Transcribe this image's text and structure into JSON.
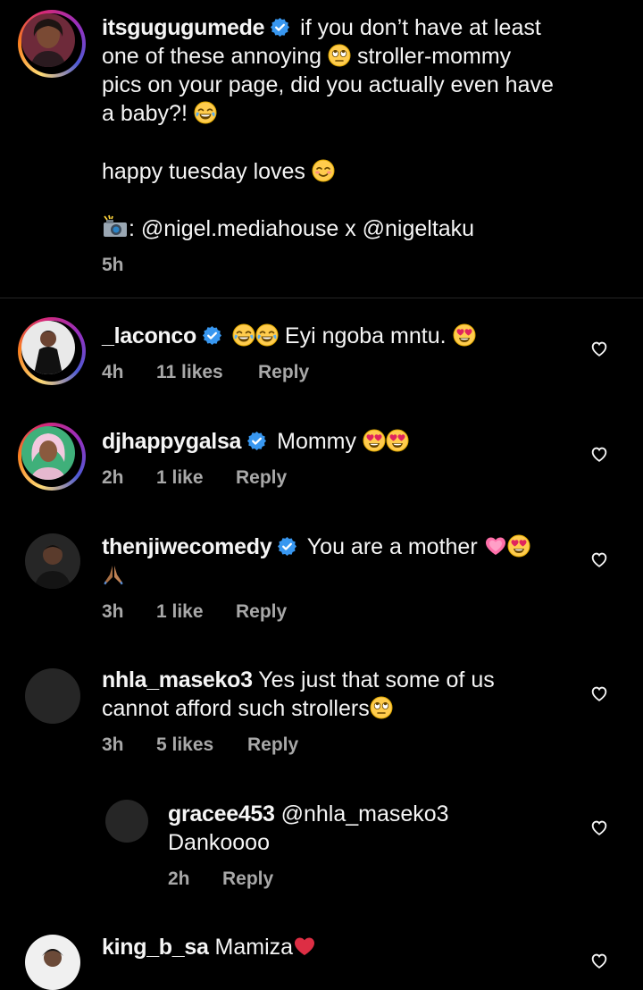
{
  "caption": {
    "username": "itsgugugumede",
    "line1": "if you don’t have at least",
    "line2a": "one of these annoying",
    "line2b": "stroller-mommy",
    "line3": "pics on your page, did you actually even have",
    "line4": "a baby?!",
    "line5": "happy tuesday loves",
    "line6": ": @nigel.mediahouse x @nigeltaku",
    "time": "5h"
  },
  "comments": [
    {
      "username": "_laconco",
      "text": "Eyi ngoba mntu.",
      "time": "4h",
      "likes": "11 likes",
      "reply": "Reply"
    },
    {
      "username": "djhappygalsa",
      "text": "Mommy",
      "time": "2h",
      "likes": "1 like",
      "reply": "Reply"
    },
    {
      "username": "thenjiwecomedy",
      "text": "You are a mother",
      "time": "3h",
      "likes": "1 like",
      "reply": "Reply"
    },
    {
      "username": "nhla_maseko3",
      "line1": "Yes just that some of us",
      "line2": "cannot afford such strollers",
      "time": "3h",
      "likes": "5 likes",
      "reply": "Reply"
    },
    {
      "username": "gracee453",
      "line1": "@nhla_maseko3",
      "line2": "Dankoooo",
      "time": "2h",
      "reply": "Reply"
    },
    {
      "username": "king_b_sa",
      "text": "Mamiza"
    }
  ],
  "colors": {
    "background": "#000000",
    "text": "#f5f5f5",
    "meta": "#a8a8a8",
    "verified": "#3897f0",
    "divider": "#262626"
  },
  "icons": [
    "verified-badge-icon",
    "heart-icon",
    "camera-flash-icon"
  ]
}
